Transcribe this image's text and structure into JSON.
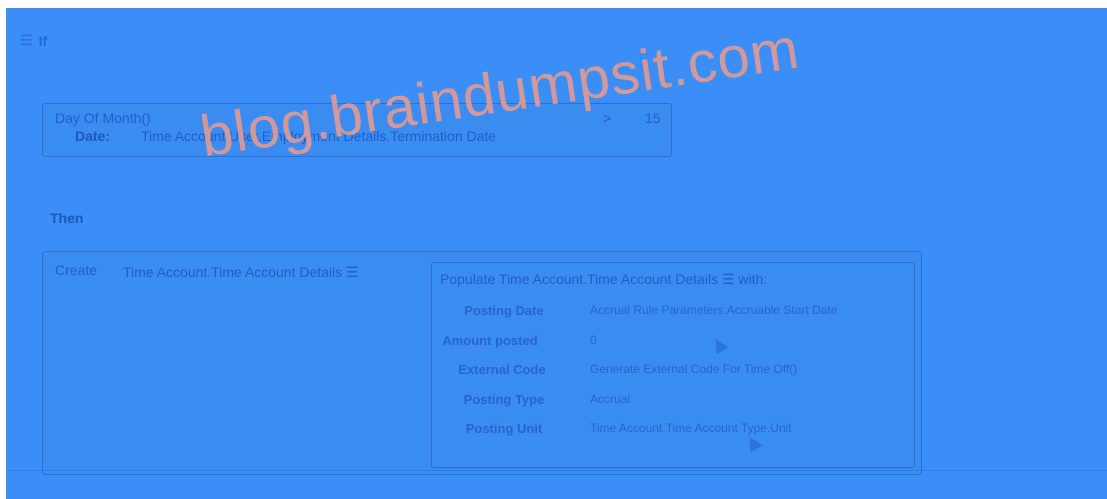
{
  "header": {
    "menu_icon": "hamburger-icon",
    "title": "If"
  },
  "condition": {
    "function": "Day Of Month()",
    "operator": ">",
    "value": "15",
    "param_label": "Date:",
    "param_value": "Time Account.User.Employment Details.Termination Date"
  },
  "then": {
    "label": "Then"
  },
  "create": {
    "label": "Create",
    "target": "Time Account.Time Account Details ☰"
  },
  "populate": {
    "title": "Populate Time Account.Time Account Details ☰ with:",
    "fields": [
      {
        "label": "Posting Date",
        "value": "Accrual Rule Parameters.Accruable Start Date"
      },
      {
        "label": "Amount posted",
        "value": "0"
      },
      {
        "label": "External Code",
        "value": "Generate External Code For Time Off()"
      },
      {
        "label": "Posting Type",
        "value": "Accrual"
      },
      {
        "label": "Posting Unit",
        "value": "Time Account.Time Account Type.Unit"
      }
    ]
  },
  "watermark": "blog.braindumpsit.com",
  "colors": {
    "overlay": "#3b8ef5",
    "watermark": "#dc9a96"
  }
}
